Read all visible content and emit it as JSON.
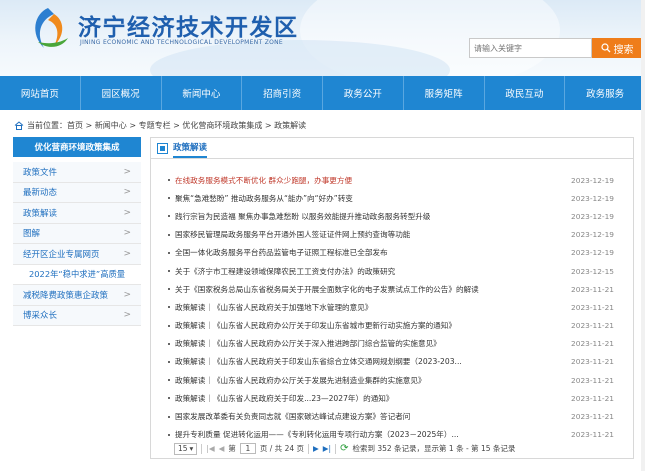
{
  "header": {
    "title": "济宁经济技术开发区",
    "subtitle": "JINING ECONOMIC AND TECHNOLOGICAL DEVELOPMENT ZONE",
    "search_placeholder": "请输入关键字",
    "search_button": "搜索"
  },
  "nav": {
    "items": [
      "网站首页",
      "园区概况",
      "新闻中心",
      "招商引资",
      "政务公开",
      "服务矩阵",
      "政民互动",
      "政务服务"
    ]
  },
  "breadcrumb": {
    "text": "当前位置：首页 > 新闻中心 > 专题专栏 > 优化营商环境政策集成 > 政策解读"
  },
  "sidebar": {
    "title": "优化营商环境政策集成",
    "items": [
      {
        "label": "政策文件",
        "chevron": ">"
      },
      {
        "label": "最新动态",
        "chevron": ">"
      },
      {
        "label": "政策解读",
        "chevron": ">"
      },
      {
        "label": "图解",
        "chevron": ">"
      },
      {
        "label": "经开区企业专属网页",
        "chevron": ">"
      },
      {
        "label": "2022年“稳中求进”高质量",
        "chevron": ""
      },
      {
        "label": "减税降费政策惠企政策",
        "chevron": ">"
      },
      {
        "label": "博采众长",
        "chevron": ">"
      }
    ]
  },
  "main": {
    "tab_label": "政策解读",
    "news": [
      {
        "title": "在线政务服务模式不断优化 群众少跑腿，办事更方便",
        "date": "2023-12-19",
        "highlight": true
      },
      {
        "title": "聚焦“急难愁盼” 推动政务服务从“能办”向“好办”转变",
        "date": "2023-12-19",
        "highlight": false
      },
      {
        "title": "践行宗旨为民造福 聚焦办事急难愁盼 以服务效能提升推动政务服务转型升级",
        "date": "2023-12-19",
        "highlight": false
      },
      {
        "title": "国家移民管理局政务服务平台开通外国人签证证件网上预约查询等功能",
        "date": "2023-12-19",
        "highlight": false
      },
      {
        "title": "全国一体化政务服务平台药品监管电子证照工程标准已全部发布",
        "date": "2023-12-19",
        "highlight": false
      },
      {
        "title": "关于《济宁市工程建设领域保障农民工工资支付办法》的政策研究",
        "date": "2023-12-15",
        "highlight": false
      },
      {
        "title": "关于《国家税务总局山东省税务局关于开展全面数字化的电子发票试点工作的公告》的解读",
        "date": "2023-11-21",
        "highlight": false
      },
      {
        "title": "政策解读｜《山东省人民政府关于加强地下水管理的意见》",
        "date": "2023-11-21",
        "highlight": false
      },
      {
        "title": "政策解读｜《山东省人民政府办公厅关于印发山东省城市更新行动实施方案的通知》",
        "date": "2023-11-21",
        "highlight": false
      },
      {
        "title": "政策解读｜《山东省人民政府办公厅关于深入推进跨部门综合监管的实施意见》",
        "date": "2023-11-21",
        "highlight": false
      },
      {
        "title": "政策解读｜《山东省人民政府关于印发山东省综合立体交通网规划纲要（2023-203...",
        "date": "2023-11-21",
        "highlight": false
      },
      {
        "title": "政策解读｜《山东省人民政府办公厅关于发展先进制造业集群的实施意见》",
        "date": "2023-11-21",
        "highlight": false
      },
      {
        "title": "政策解读｜《山东省人民政府关于印发...23—2027年）的通知》",
        "date": "2023-11-21",
        "highlight": false
      },
      {
        "title": "国家发展改革委有关负责同志就《国家碳达峰试点建设方案》答记者问",
        "date": "2023-11-21",
        "highlight": false
      },
      {
        "title": "提升专利质量 促进转化运用——《专利转化运用专项行动方案（2023－2025年）...",
        "date": "2023-11-21",
        "highlight": false
      }
    ]
  },
  "pager": {
    "page_size": "15",
    "page_prefix": "第",
    "current_page": "1",
    "page_suffix": "页 / 共 24 页",
    "summary": "检索到 352 条记录，显示第 1 条 - 第 15 条记录"
  },
  "colors": {
    "nav_blue": "#1f86d2",
    "search_orange": "#ef7d1a",
    "highlight_red": "#c0392b"
  },
  "icons": [
    "logo-emblem",
    "search-icon",
    "home-icon",
    "tab-icon",
    "first-page-icon",
    "prev-page-icon",
    "next-page-icon",
    "last-page-icon",
    "refresh-icon"
  ]
}
